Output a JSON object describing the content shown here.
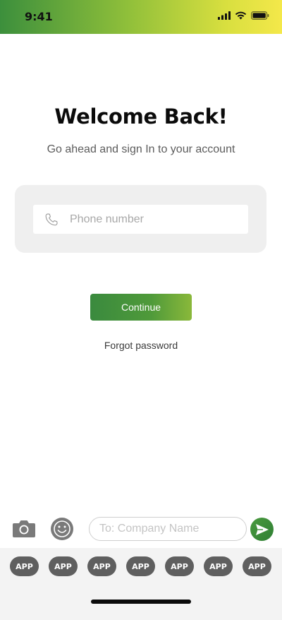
{
  "status_bar": {
    "time": "9:41",
    "icons": [
      "cellular-signal-icon",
      "wifi-icon",
      "battery-icon"
    ]
  },
  "login": {
    "title": "Welcome Back!",
    "subtitle": "Go ahead and sign In to your account",
    "phone_placeholder": "Phone number",
    "phone_icon": "phone-icon",
    "continue_label": "Continue",
    "forgot_label": "Forgot password"
  },
  "message_bar": {
    "camera_icon": "camera-icon",
    "emoji_icon": "emoji-icon",
    "input_placeholder": "To: Company Name",
    "send_icon": "send-icon"
  },
  "app_tray": {
    "apps": [
      "APP",
      "APP",
      "APP",
      "APP",
      "APP",
      "APP",
      "APP"
    ]
  },
  "colors": {
    "brand_green": "#3a8a3e",
    "brand_yellow": "#f4e84a",
    "card_gray": "#efefef",
    "app_button_gray": "#5f5f5f"
  }
}
